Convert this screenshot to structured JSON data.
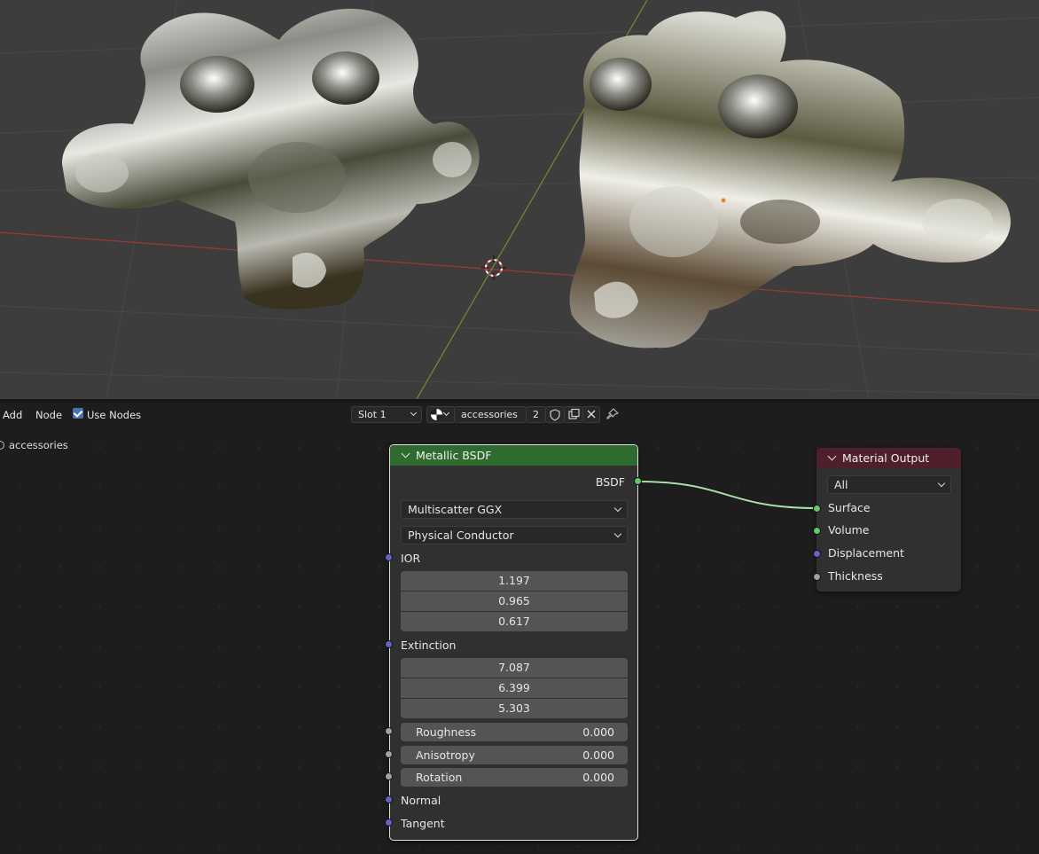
{
  "header": {
    "add_label": "Add",
    "node_label": "Node",
    "use_nodes_label": "Use Nodes",
    "use_nodes_checked": true,
    "slot_label": "Slot 1",
    "material_name": "accessories",
    "user_count": "2"
  },
  "editor": {
    "material_breadcrumb": "accessories"
  },
  "metallic_node": {
    "title": "Metallic BSDF",
    "output_label": "BSDF",
    "distribution": "Multiscatter GGX",
    "fresnel_type": "Physical Conductor",
    "ior_label": "IOR",
    "ior_values": [
      "1.197",
      "0.965",
      "0.617"
    ],
    "extinction_label": "Extinction",
    "extinction_values": [
      "7.087",
      "6.399",
      "5.303"
    ],
    "roughness_label": "Roughness",
    "roughness_value": "0.000",
    "anisotropy_label": "Anisotropy",
    "anisotropy_value": "0.000",
    "rotation_label": "Rotation",
    "rotation_value": "0.000",
    "normal_label": "Normal",
    "tangent_label": "Tangent",
    "header_color": "#2f6b2f"
  },
  "output_node": {
    "title": "Material Output",
    "target": "All",
    "surface_label": "Surface",
    "volume_label": "Volume",
    "displacement_label": "Displacement",
    "thickness_label": "Thickness",
    "header_color": "#4f1f2b"
  },
  "colors": {
    "viewport_bg": "#3d3d3d",
    "editor_bg": "#1d1d1d",
    "accent": "#4772b3",
    "socket_shader": "#63c763",
    "socket_vector": "#6363c7",
    "socket_float": "#a1a1a1",
    "x_axis": "#b03a3a",
    "y_axis": "#6f8f2e"
  }
}
